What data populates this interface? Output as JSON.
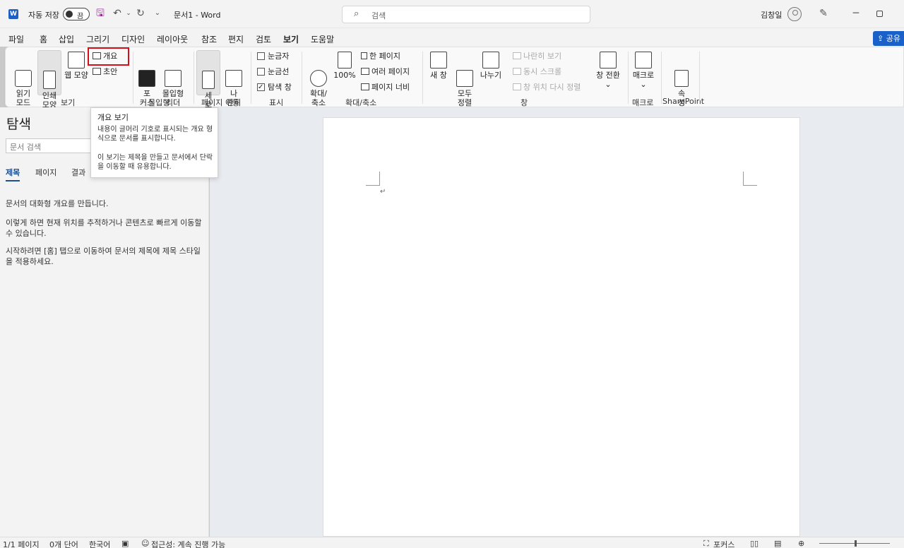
{
  "titlebar": {
    "autosave_label": "자동 저장",
    "autosave_state": "끔",
    "doc_title": "문서1  -  Word",
    "search_placeholder": "검색",
    "user_name": "김창일"
  },
  "menu": {
    "tabs": [
      "파일",
      "홈",
      "삽입",
      "그리기",
      "디자인",
      "레이아웃",
      "참조",
      "편지",
      "검토",
      "보기",
      "도움말"
    ],
    "active_tab": "보기",
    "share_label": "공유"
  },
  "ribbon": {
    "view": {
      "group_label": "보기",
      "read_mode": "읽기\n모드",
      "print_layout": "인쇄\n모양",
      "web_layout": "웹 모양",
      "outline": "개요",
      "draft": "초안"
    },
    "immersive": {
      "group_label": "몰입형",
      "focus": "포\n커스",
      "immersive_reader": "몰입형\n리더"
    },
    "page_movement": {
      "group_label": "페이지 이동",
      "vertical": "세\n로",
      "side_by_side": "나\n란히"
    },
    "show": {
      "group_label": "표시",
      "ruler": "눈금자",
      "gridlines": "눈금선",
      "nav_pane": "탐색 창"
    },
    "zoom": {
      "group_label": "확대/축소",
      "zoom": "확대/\n축소",
      "zoom_100": "100%",
      "one_page": "한 페이지",
      "multiple_pages": "여러 페이지",
      "page_width": "페이지 너비"
    },
    "window": {
      "group_label": "창",
      "new_window": "새 창",
      "arrange_all": "모두\n정렬",
      "split": "나누기",
      "view_side_by_side": "나란히 보기",
      "sync_scroll": "동시 스크롤",
      "reset_position": "창 위치 다시 정렬",
      "switch_windows": "창 전환"
    },
    "macros": {
      "group_label": "매크로",
      "macros": "매크로"
    },
    "sharepoint": {
      "group_label": "SharePoint",
      "properties": "속\n성"
    }
  },
  "tooltip": {
    "title": "개요 보기",
    "p1": "내용이 글머리 기호로 표시되는 개요 형식으로 문서를 표시합니다.",
    "p2": "이 보기는 제목을 만들고 문서에서 단락을 이동할 때 유용합니다."
  },
  "nav_pane": {
    "title": "탐색",
    "search_placeholder": "문서 검색",
    "tabs": [
      "제목",
      "페이지",
      "결과"
    ],
    "p1": "문서의 대화형 개요를 만듭니다.",
    "p2": "이렇게 하면 현재 위치를 추적하거나 콘텐츠로 빠르게 이동할 수 있습니다.",
    "p3": "시작하려면 [홈] 탭으로 이동하여 문서의 제목에 제목 스타일을 적용하세요."
  },
  "statusbar": {
    "page": "1/1 페이지",
    "words": "0개 단어",
    "language": "한국어",
    "accessibility": "접근성: 계속 진행 가능",
    "focus": "포커스"
  },
  "colors": {
    "accent": "#2b579a",
    "share": "#1a60c9",
    "highlight": "#d4111a"
  }
}
